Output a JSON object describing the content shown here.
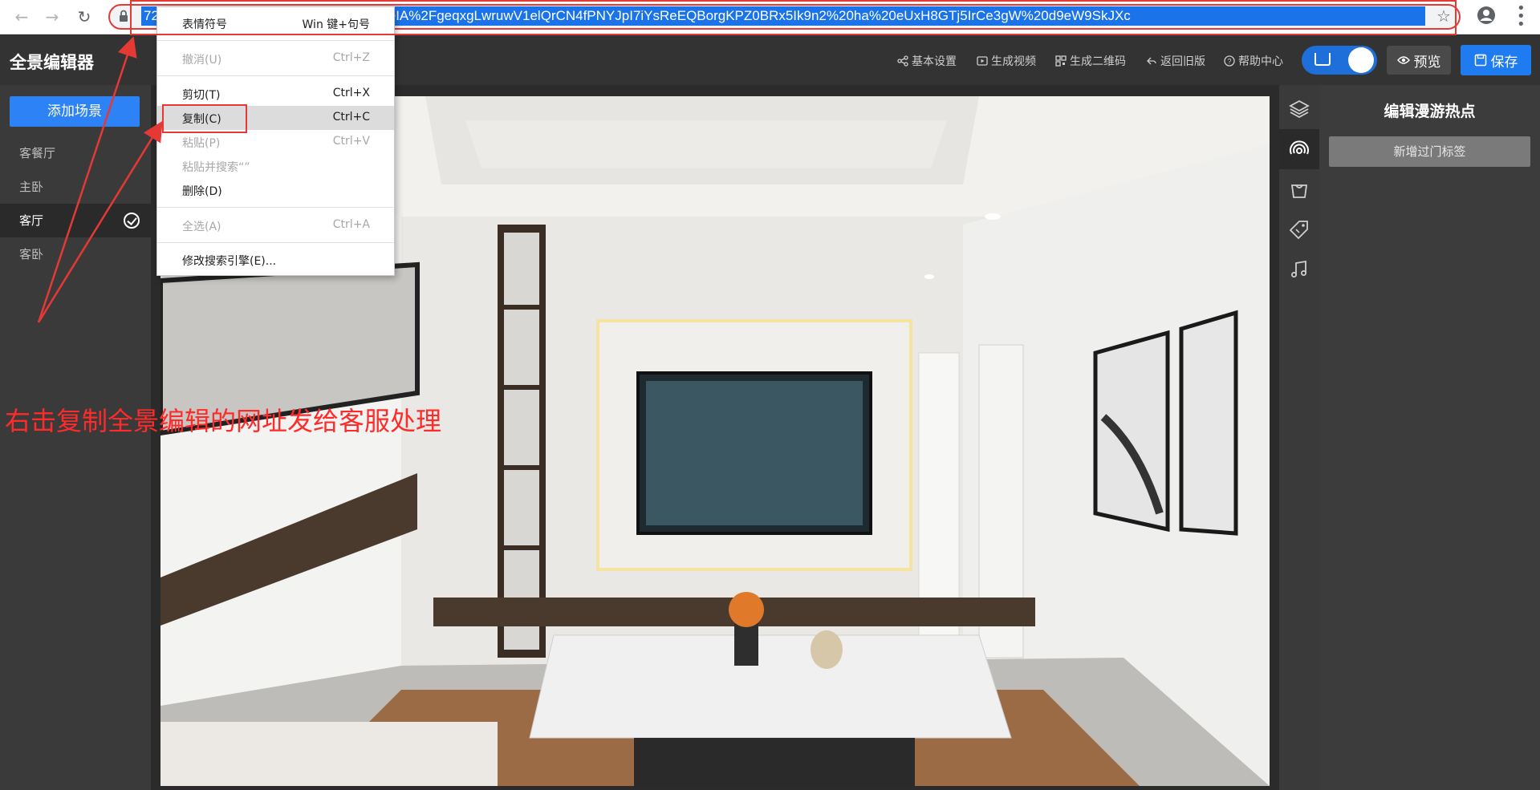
{
  "browser": {
    "url_visible": "72 de=nKLQ4hmjzq9HtK5BdlByctJShsPeIA%2FgeqxgLwruwV1elQrCN4fPNYJpI7iYsReEQBorgKPZ0BRx5Ik9n2%20ha%20eUxH8GTj5IrCe3gW%20d9eW9SkJXc"
  },
  "header": {
    "title": "全景编辑器",
    "links": [
      {
        "label": "基本设置",
        "icon": "share-icon"
      },
      {
        "label": "生成视频",
        "icon": "video-icon"
      },
      {
        "label": "生成二维码",
        "icon": "qrcode-icon"
      },
      {
        "label": "返回旧版",
        "icon": "return-icon"
      },
      {
        "label": "帮助中心",
        "icon": "help-icon"
      }
    ],
    "preview_label": "预览",
    "save_label": "保存"
  },
  "sidebar": {
    "add_scene_label": "添加场景",
    "scenes": [
      {
        "label": "客餐厅",
        "active": false
      },
      {
        "label": "主卧",
        "active": false
      },
      {
        "label": "客厅",
        "active": true
      },
      {
        "label": "客卧",
        "active": false
      }
    ]
  },
  "tools": [
    "layers-icon",
    "hotspot-icon",
    "bag-icon",
    "tag-icon",
    "music-icon"
  ],
  "right_panel": {
    "title": "编辑漫游热点",
    "add_tag_label": "新增过门标签"
  },
  "context_menu": {
    "items": [
      {
        "label": "表情符号",
        "shortcut": "Win 键+句号",
        "disabled": false
      },
      {
        "label": "撤消(U)",
        "shortcut": "Ctrl+Z",
        "disabled": true
      },
      {
        "label": "剪切(T)",
        "shortcut": "Ctrl+X",
        "disabled": false
      },
      {
        "label": "复制(C)",
        "shortcut": "Ctrl+C",
        "disabled": false,
        "highlighted": true
      },
      {
        "label": "粘贴(P)",
        "shortcut": "Ctrl+V",
        "disabled": true
      },
      {
        "label": "粘贴并搜索“”",
        "shortcut": "",
        "disabled": true
      },
      {
        "label": "删除(D)",
        "shortcut": "",
        "disabled": false
      },
      {
        "label": "全选(A)",
        "shortcut": "Ctrl+A",
        "disabled": true
      },
      {
        "label": "修改搜索引擎(E)...",
        "shortcut": "",
        "disabled": false
      }
    ]
  },
  "annotation": {
    "text": "右击复制全景编辑的网址发给客服处理",
    "color": "#ff2a2a"
  },
  "colors": {
    "accent": "#1e7bf0",
    "annotation_red": "#e53935"
  }
}
